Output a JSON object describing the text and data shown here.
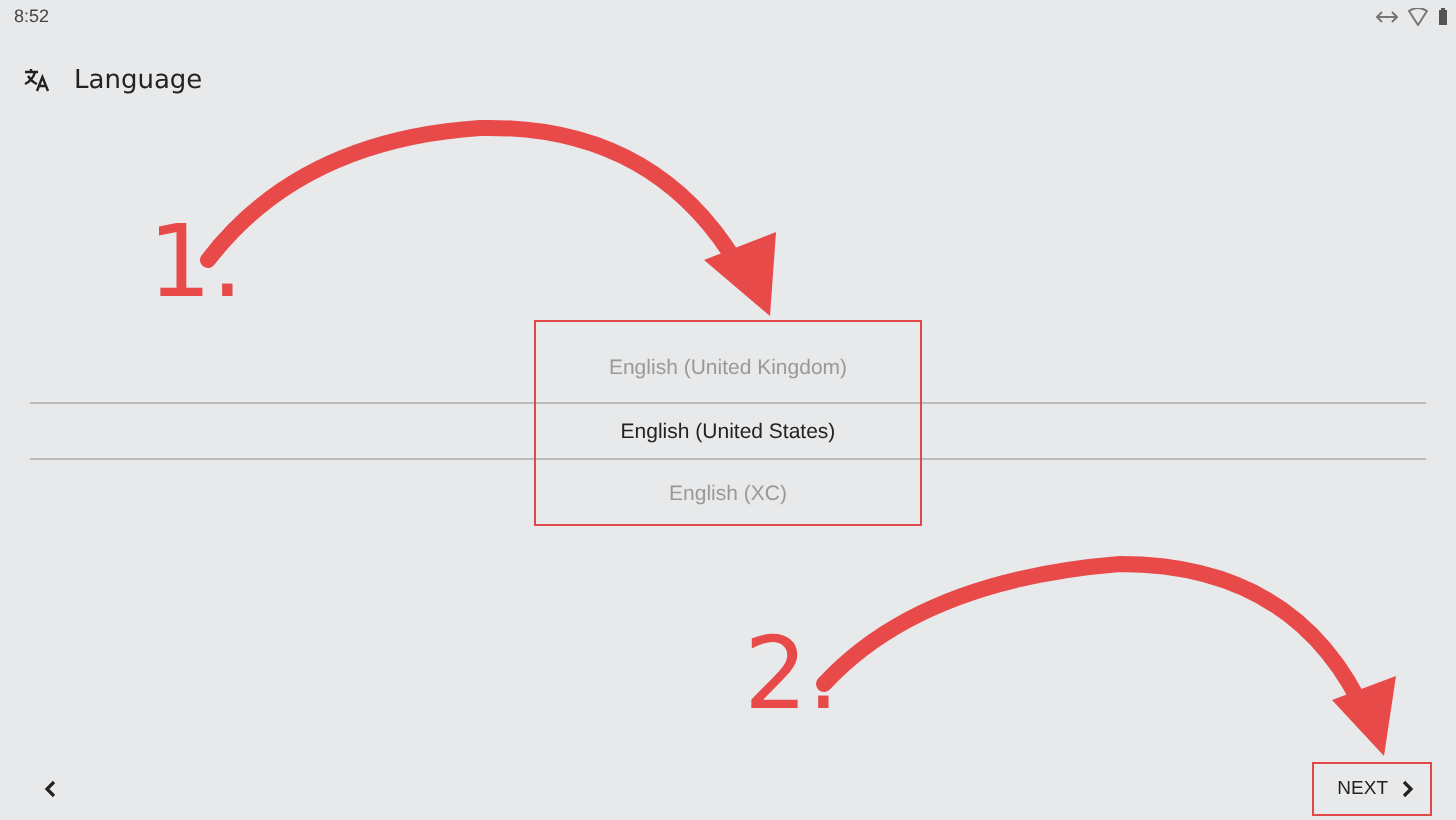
{
  "status_bar": {
    "time": "8:52"
  },
  "header": {
    "title": "Language"
  },
  "picker": {
    "items": [
      {
        "label": "English (United Kingdom)",
        "selected": false
      },
      {
        "label": "English (United States)",
        "selected": true
      },
      {
        "label": "English (XC)",
        "selected": false
      }
    ]
  },
  "footer": {
    "next_label": "NEXT"
  },
  "annotations": [
    {
      "label": "1."
    },
    {
      "label": "2."
    }
  ]
}
